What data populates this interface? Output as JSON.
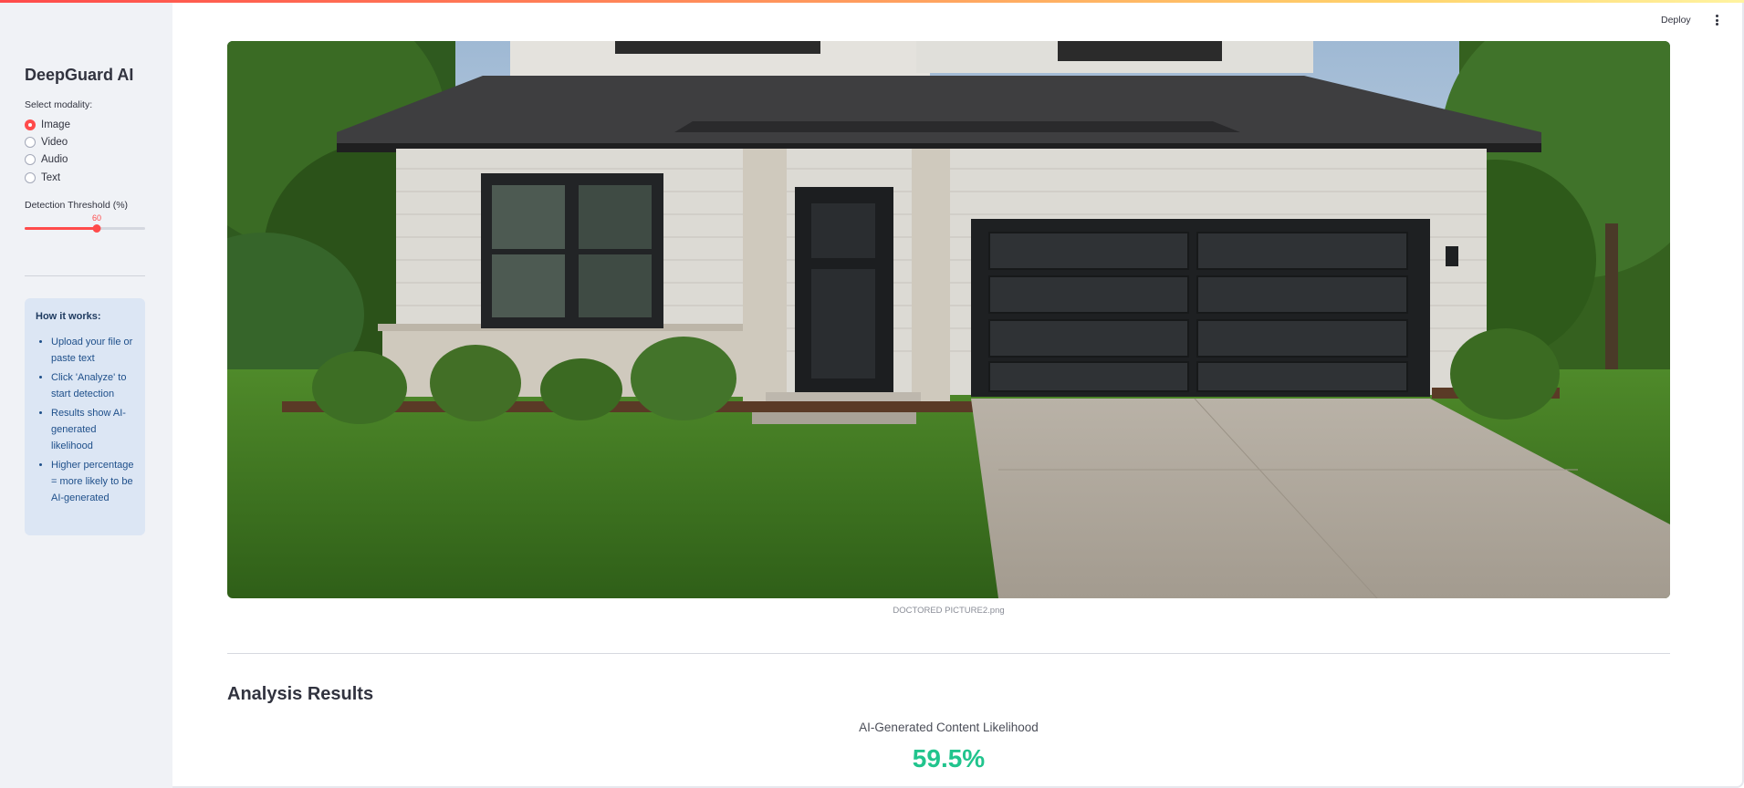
{
  "sidebar": {
    "title": "DeepGuard AI",
    "modality_label": "Select modality:",
    "modalities": [
      "Image",
      "Video",
      "Audio",
      "Text"
    ],
    "selected_modality": "Image",
    "threshold_label": "Detection Threshold (%)",
    "threshold_value": 60,
    "threshold_min": 0,
    "threshold_max": 100,
    "info": {
      "title": "How it works:",
      "items": [
        "Upload your file or paste text",
        "Click 'Analyze' to start detection",
        "Results show AI-generated likelihood",
        "Higher percentage = more likely to be AI-generated"
      ]
    }
  },
  "header": {
    "deploy_label": "Deploy",
    "menu_icon": "kebab-menu-icon"
  },
  "main": {
    "image_caption": "DOCTORED PICTURE2.png",
    "results_title": "Analysis Results",
    "likelihood_label": "AI-Generated Content Likelihood",
    "likelihood_value": "59.5%"
  },
  "colors": {
    "accent": "#ff4b4b",
    "result": "#21c48d",
    "sidebar_bg": "#f0f2f6",
    "info_bg": "#dce6f4"
  }
}
